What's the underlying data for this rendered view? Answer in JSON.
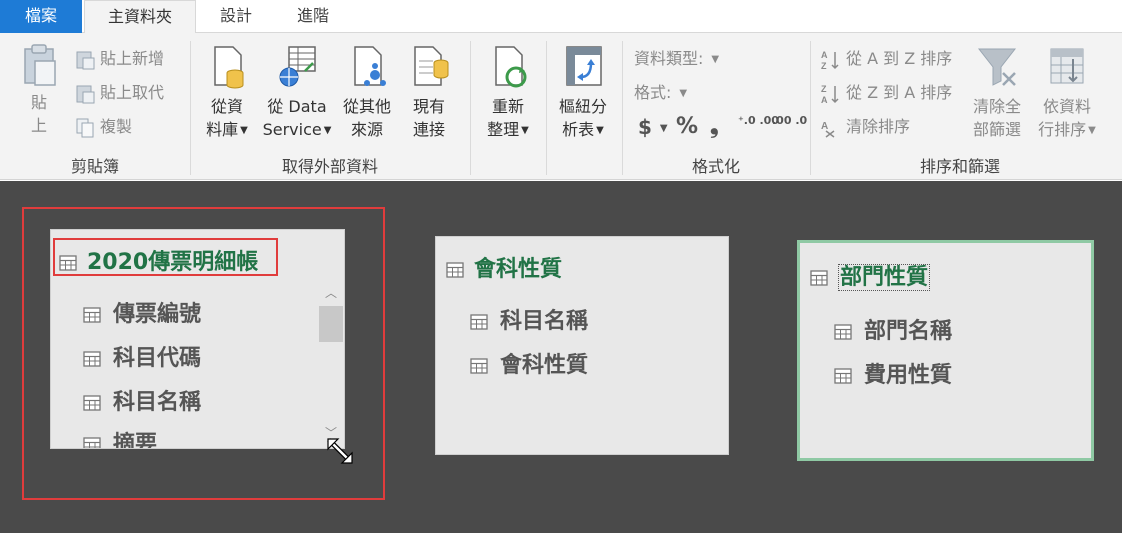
{
  "tabs": {
    "file": "檔案",
    "home": "主資料夾",
    "design": "設計",
    "advanced": "進階"
  },
  "clipboard": {
    "paste_line1": "貼",
    "paste_line2": "上",
    "paste_append": "貼上新增",
    "paste_replace": "貼上取代",
    "copy": "複製",
    "group_label": "剪貼簿"
  },
  "external": {
    "from_db_line1": "從資",
    "from_db_line2": "料庫",
    "from_service_line1": "從 Data",
    "from_service_line2": "Service",
    "from_other_line1": "從其他",
    "from_other_line2": "來源",
    "existing_line1": "現有",
    "existing_line2": "連接",
    "group_label": "取得外部資料"
  },
  "refresh": {
    "line1": "重新",
    "line2": "整理"
  },
  "pivot": {
    "line1": "樞紐分",
    "line2": "析表"
  },
  "format": {
    "data_type": "資料類型:",
    "format": "格式:",
    "currency": "$",
    "percent": "%",
    "comma": "❟",
    "inc_decimal": "⁺.0 .00",
    "dec_decimal": ".00 .0",
    "group_label": "格式化"
  },
  "sort": {
    "asc": "從 A 到 Z 排序",
    "desc": "從 Z 到 A 排序",
    "clear_sort": "清除排序",
    "clear_filter_line1": "清除全",
    "clear_filter_line2": "部篩選",
    "by_column_line1": "依資料",
    "by_column_line2": "行排序",
    "group_label": "排序和篩選"
  },
  "diagram": {
    "tables": [
      {
        "title": "2020傳票明細帳",
        "fields": [
          "傳票編號",
          "科目代碼",
          "科目名稱",
          "摘要"
        ]
      },
      {
        "title": "會科性質",
        "fields": [
          "科目名稱",
          "會科性質"
        ]
      },
      {
        "title": "部門性質",
        "fields": [
          "部門名稱",
          "費用性質"
        ]
      }
    ]
  },
  "colors": {
    "accent_green": "#217346",
    "file_tab_blue": "#1e7bd6",
    "selection_red": "#e03c3c",
    "canvas_bg": "#4a4a4a"
  }
}
